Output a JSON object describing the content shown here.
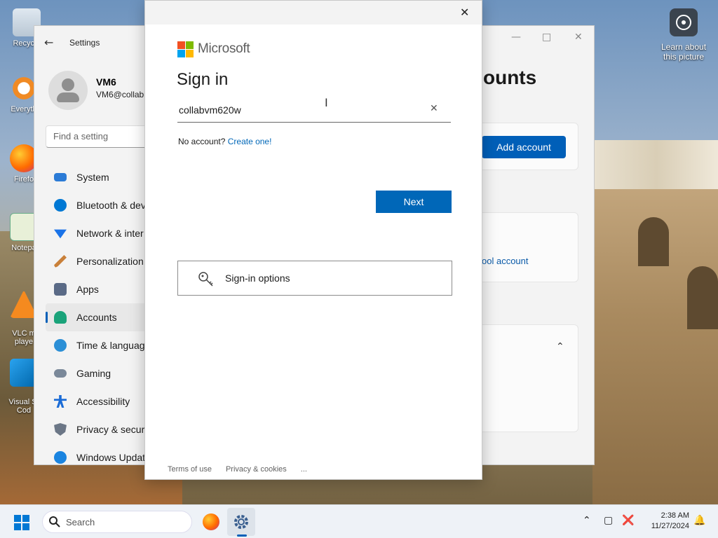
{
  "desktop": {
    "icons": [
      {
        "label": "Recycle"
      },
      {
        "label": "Everyth"
      },
      {
        "label": "Firefo"
      },
      {
        "label": "Notepa"
      },
      {
        "label": "VLC m\nplaye"
      },
      {
        "label": "Visual St\nCod"
      }
    ],
    "learn_about": "Learn about\nthis picture"
  },
  "settings": {
    "title": "Settings",
    "user_name": "VM6",
    "user_email": "VM6@collab",
    "search_placeholder": "Find a setting",
    "nav": [
      {
        "label": "System",
        "color": "#2b7bd6"
      },
      {
        "label": "Bluetooth & dev",
        "color": "#0078d4"
      },
      {
        "label": "Network & inter",
        "color": "#1a73e8"
      },
      {
        "label": "Personalization",
        "color": "#c9803a"
      },
      {
        "label": "Apps",
        "color": "#5a6a86"
      },
      {
        "label": "Accounts",
        "color": "#1aa37a"
      },
      {
        "label": "Time & languag",
        "color": "#2b8fd6"
      },
      {
        "label": "Gaming",
        "color": "#7a8899"
      },
      {
        "label": "Accessibility",
        "color": "#1a6bd6"
      },
      {
        "label": "Privacy & securi",
        "color": "#6b7686"
      },
      {
        "label": "Windows Updat",
        "color": "#1a84e0"
      }
    ],
    "heading": "ounts",
    "add_account": "Add account",
    "school_link": "ool account"
  },
  "dialog": {
    "brand": "Microsoft",
    "heading": "Sign in",
    "email_value": "collabvm620w",
    "no_account": "No account?",
    "create_link": "Create one!",
    "next_label": "Next",
    "options_label": "Sign-in options",
    "footer_terms": "Terms of use",
    "footer_privacy": "Privacy & cookies",
    "footer_more": "..."
  },
  "taskbar": {
    "search_label": "Search",
    "time": "2:38 AM",
    "date": "11/27/2024"
  },
  "colors": {
    "accent": "#0067b8",
    "settings_accent": "#005fb8"
  }
}
